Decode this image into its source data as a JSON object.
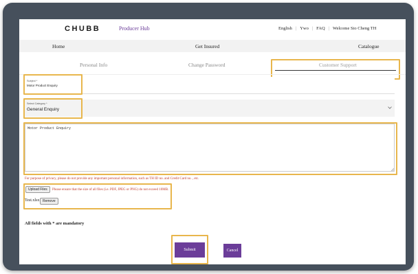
{
  "header": {
    "logo": "CHUBB",
    "product": "Producer Hub",
    "links": [
      "English",
      "Ywo",
      "FAQ",
      "Welcome Sio Cheng TH"
    ]
  },
  "nav": {
    "home": "Home",
    "get_insured": "Get Insured",
    "catalogue": "Catalogue"
  },
  "subtabs": {
    "personal_info": "Personal Info",
    "change_password": "Change Password",
    "customer_support": "Customer Support"
  },
  "form": {
    "subject_label": "Subject *",
    "subject_value": "Motor Product Enquiry",
    "category_label": "Select Category *",
    "category_value": "General Enquiry",
    "message_value": "Motor Product Enquiry",
    "privacy_note": "For purpose of privacy, please do not provide any important personal information, such as TH ID no. and Credit Card no. , etc.",
    "upload_button": "Upload Files",
    "upload_note": "Please ensure that the size of all files (i.e. PDF, JPEG or PNG) do not exceed 10MB.",
    "file_name": "Test.xlsx",
    "remove_button": "Remove",
    "mandatory_note": "All fields with * are mandatory",
    "submit_label": "Submit",
    "cancel_label": "Cancel"
  },
  "colors": {
    "brand_purple": "#6b3d99",
    "highlight": "#e8b64c",
    "frame": "#46505c"
  }
}
